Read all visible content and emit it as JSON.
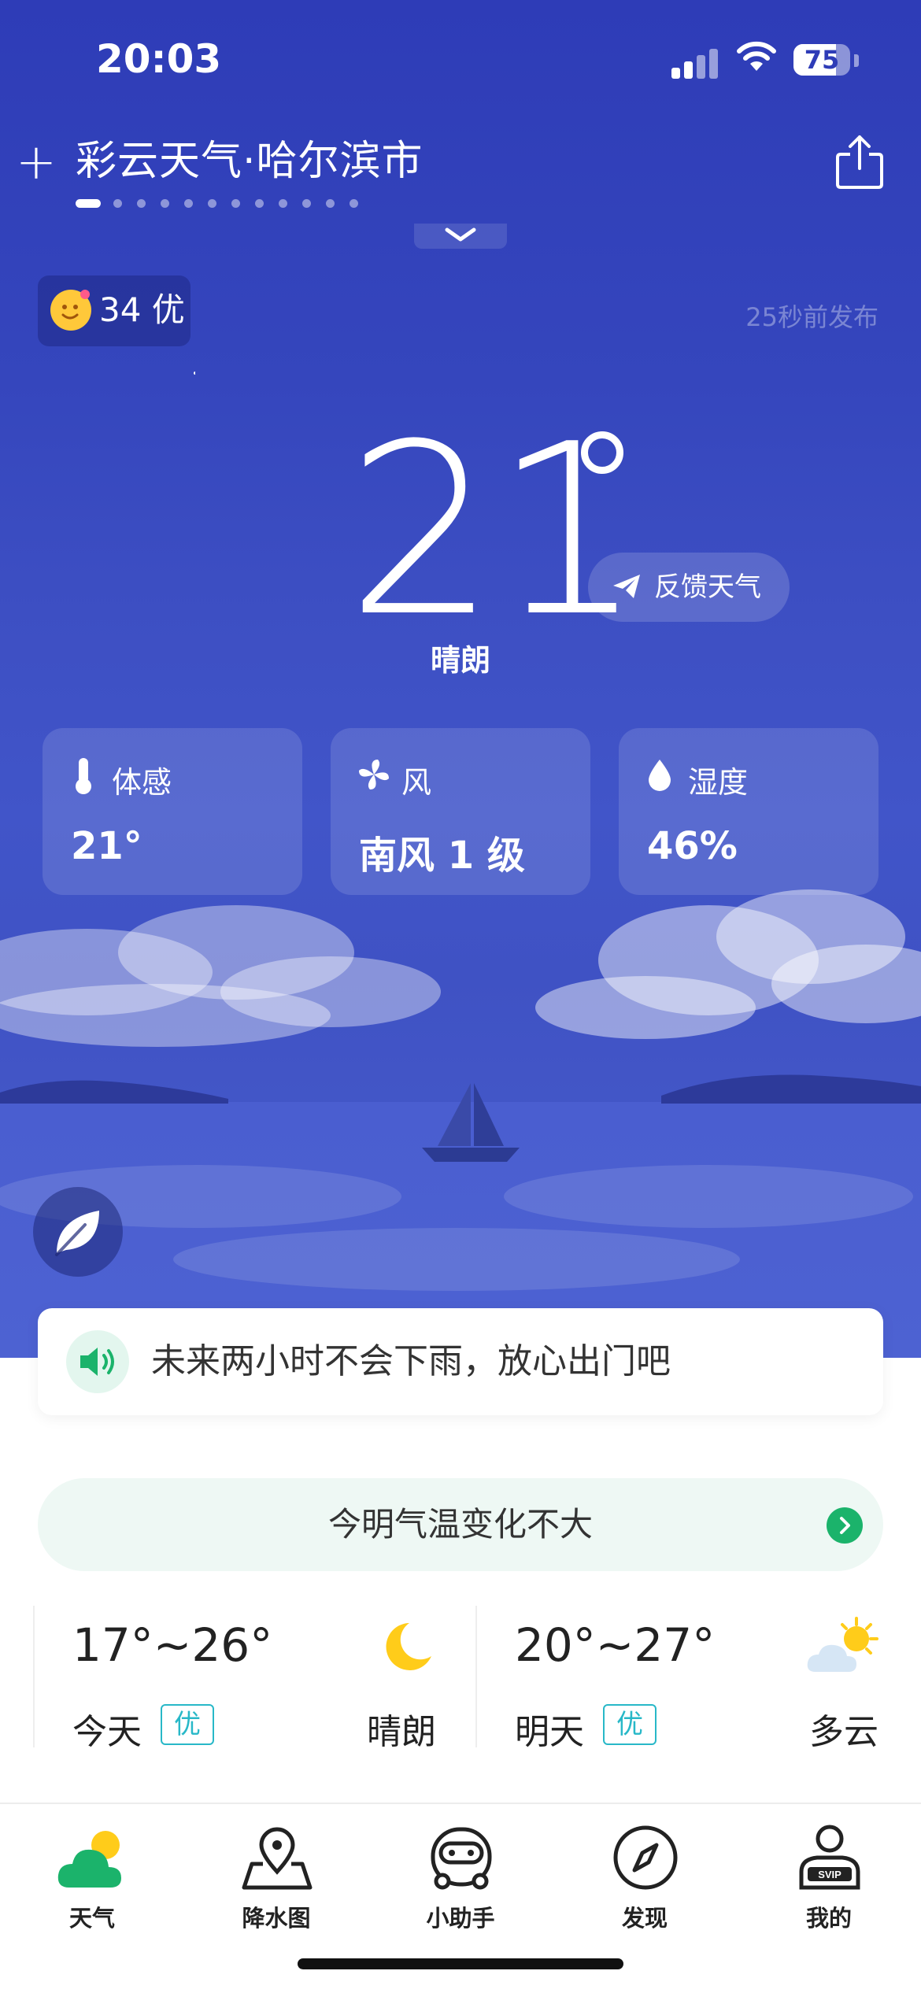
{
  "status_bar": {
    "time": "20:03",
    "battery": "75",
    "battery_level": 0.75
  },
  "header": {
    "city_title": "彩云天气·哈尔滨市",
    "page_count": 12,
    "active_page": 1
  },
  "aqi": {
    "label": "34 优"
  },
  "published": "25秒前发布",
  "current": {
    "temperature": "21",
    "condition": "晴朗",
    "feedback_label": "反馈天气"
  },
  "cards": [
    {
      "label": "体感",
      "value": "21°",
      "icon": "thermometer-icon"
    },
    {
      "label": "风",
      "value": "南风 1 级",
      "icon": "fan-icon"
    },
    {
      "label": "湿度",
      "value": "46%",
      "icon": "water-drop-icon"
    }
  ],
  "notice": {
    "text": "未来两小时不会下雨，放心出门吧",
    "icon": "speaker-icon"
  },
  "trend": {
    "text": "今明气温变化不大"
  },
  "forecast": [
    {
      "range": "17°~26°",
      "day": "今天",
      "aqi": "优",
      "condition": "晴朗",
      "icon": "moon-icon"
    },
    {
      "range": "20°~27°",
      "day": "明天",
      "aqi": "优",
      "condition": "多云",
      "icon": "partly-cloudy-icon"
    }
  ],
  "tabs": [
    {
      "label": "天气",
      "icon": "weather-icon"
    },
    {
      "label": "降水图",
      "icon": "map-pin-icon"
    },
    {
      "label": "小助手",
      "icon": "assistant-icon"
    },
    {
      "label": "发现",
      "icon": "compass-icon"
    },
    {
      "label": "我的",
      "icon": "svip-user-icon"
    }
  ],
  "colors": {
    "accent": "#1bb36b",
    "badge": "#28b8c8",
    "sky_top": "#2e3cb7",
    "sky_bottom": "#4a5ecd"
  }
}
